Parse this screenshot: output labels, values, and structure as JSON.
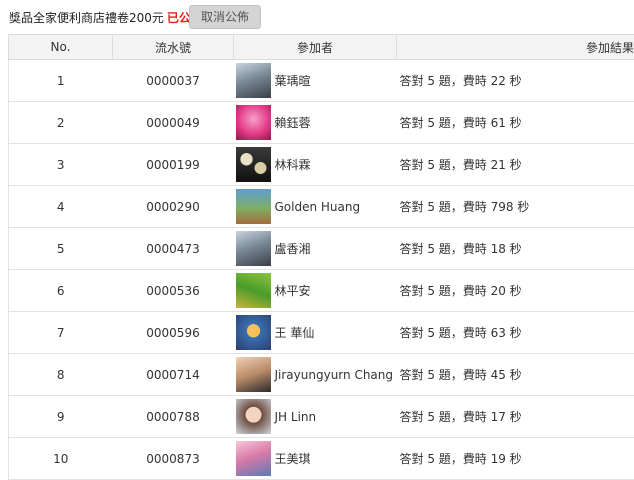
{
  "header": {
    "prize_text": "獎品全家便利商店禮卷200元",
    "status_text": "已公佈",
    "cancel_button": "取消公佈"
  },
  "columns": {
    "no": "No.",
    "serial": "流水號",
    "participant": "參加者",
    "result": "參加結果"
  },
  "rows": [
    {
      "no": "1",
      "serial": "0000037",
      "name": "葉瑀暄",
      "result": "答對 5 題，費時 22 秒",
      "avatar": "woman-portrait-photo"
    },
    {
      "no": "2",
      "serial": "0000049",
      "name": "賴鈺蓉",
      "result": "答對 5 題，費時 61 秒",
      "avatar": "pink-bear-photo"
    },
    {
      "no": "3",
      "serial": "0000199",
      "name": "林科霖",
      "result": "答對 5 題，費時 21 秒",
      "avatar": "balls-photo"
    },
    {
      "no": "4",
      "serial": "0000290",
      "name": "Golden Huang",
      "result": "答對 5 題，費時 798 秒",
      "avatar": "family-photo"
    },
    {
      "no": "5",
      "serial": "0000473",
      "name": "盧香湘",
      "result": "答對 5 題，費時 18 秒",
      "avatar": "woman-portrait-photo"
    },
    {
      "no": "6",
      "serial": "0000536",
      "name": "林平安",
      "result": "答對 5 題，費時 20 秒",
      "avatar": "wheat-field-photo"
    },
    {
      "no": "7",
      "serial": "0000596",
      "name": "王 華仙",
      "result": "答對 5 題，費時 63 秒",
      "avatar": "cartoon-photo"
    },
    {
      "no": "8",
      "serial": "0000714",
      "name": "Jirayungyurn Chang",
      "result": "答對 5 題，費時 45 秒",
      "avatar": "man-portrait-photo"
    },
    {
      "no": "9",
      "serial": "0000788",
      "name": "JH Linn",
      "result": "答對 5 題，費時 17 秒",
      "avatar": "child-photo"
    },
    {
      "no": "10",
      "serial": "0000873",
      "name": "王美琪",
      "result": "答對 5 題，費時 19 秒",
      "avatar": "children-photo"
    }
  ]
}
